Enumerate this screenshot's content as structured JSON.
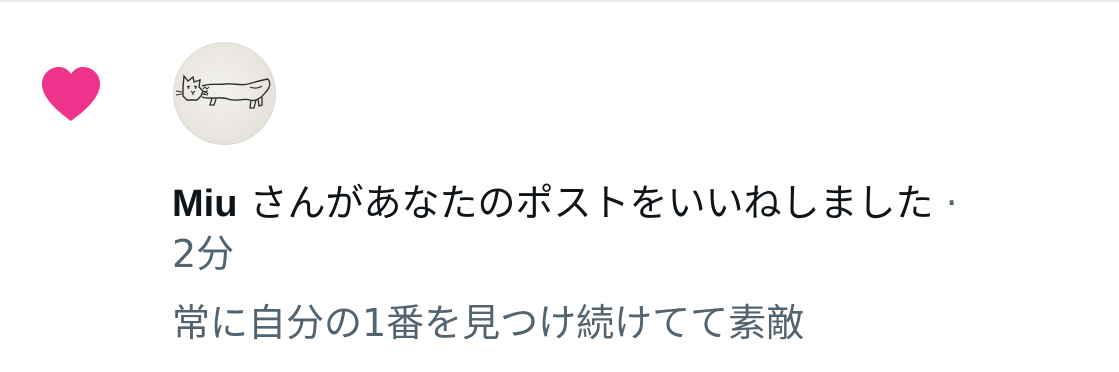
{
  "notification": {
    "user_name": "Miu",
    "action_text": "さんがあなたのポストをいいねしました",
    "separator": "·",
    "time": "2分",
    "comment": "常に自分の1番を見つけ続けてて素敵"
  },
  "colors": {
    "heart": "#f0338a",
    "text": "#0f1419",
    "muted": "#536471",
    "divider": "#e6e9ec"
  },
  "icons": {
    "like": "heart-icon",
    "avatar": "cat-sketch-avatar"
  }
}
